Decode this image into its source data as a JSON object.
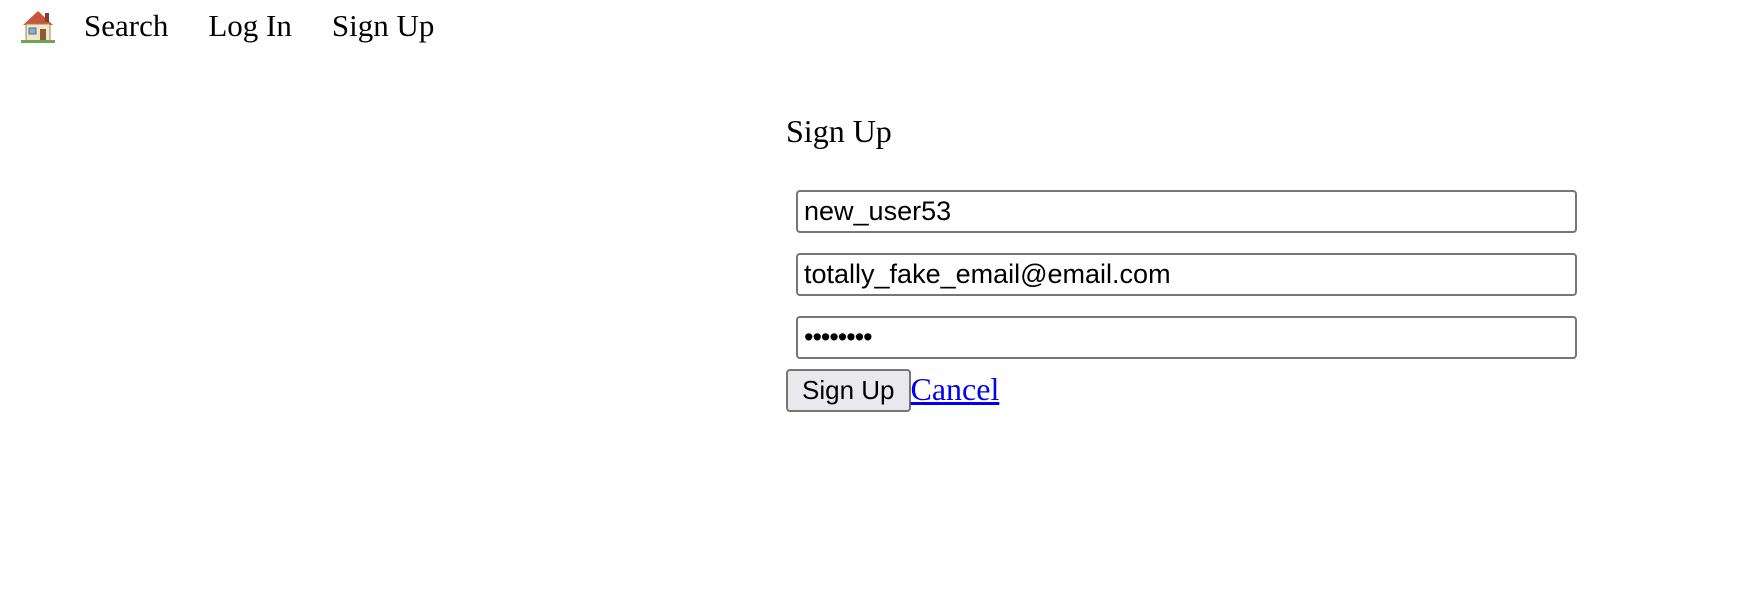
{
  "nav": {
    "home_icon": "house-icon",
    "links": [
      {
        "label": "Search"
      },
      {
        "label": "Log In"
      },
      {
        "label": "Sign Up"
      }
    ]
  },
  "form": {
    "title": "Sign Up",
    "username_value": "new_user53",
    "email_value": "totally_fake_email@email.com",
    "password_value": "passwrd!",
    "submit_label": "Sign Up",
    "cancel_label": "Cancel"
  },
  "colors": {
    "link": "#0000ee",
    "button_bg": "#e9e9ed",
    "field_border": "#767676"
  }
}
